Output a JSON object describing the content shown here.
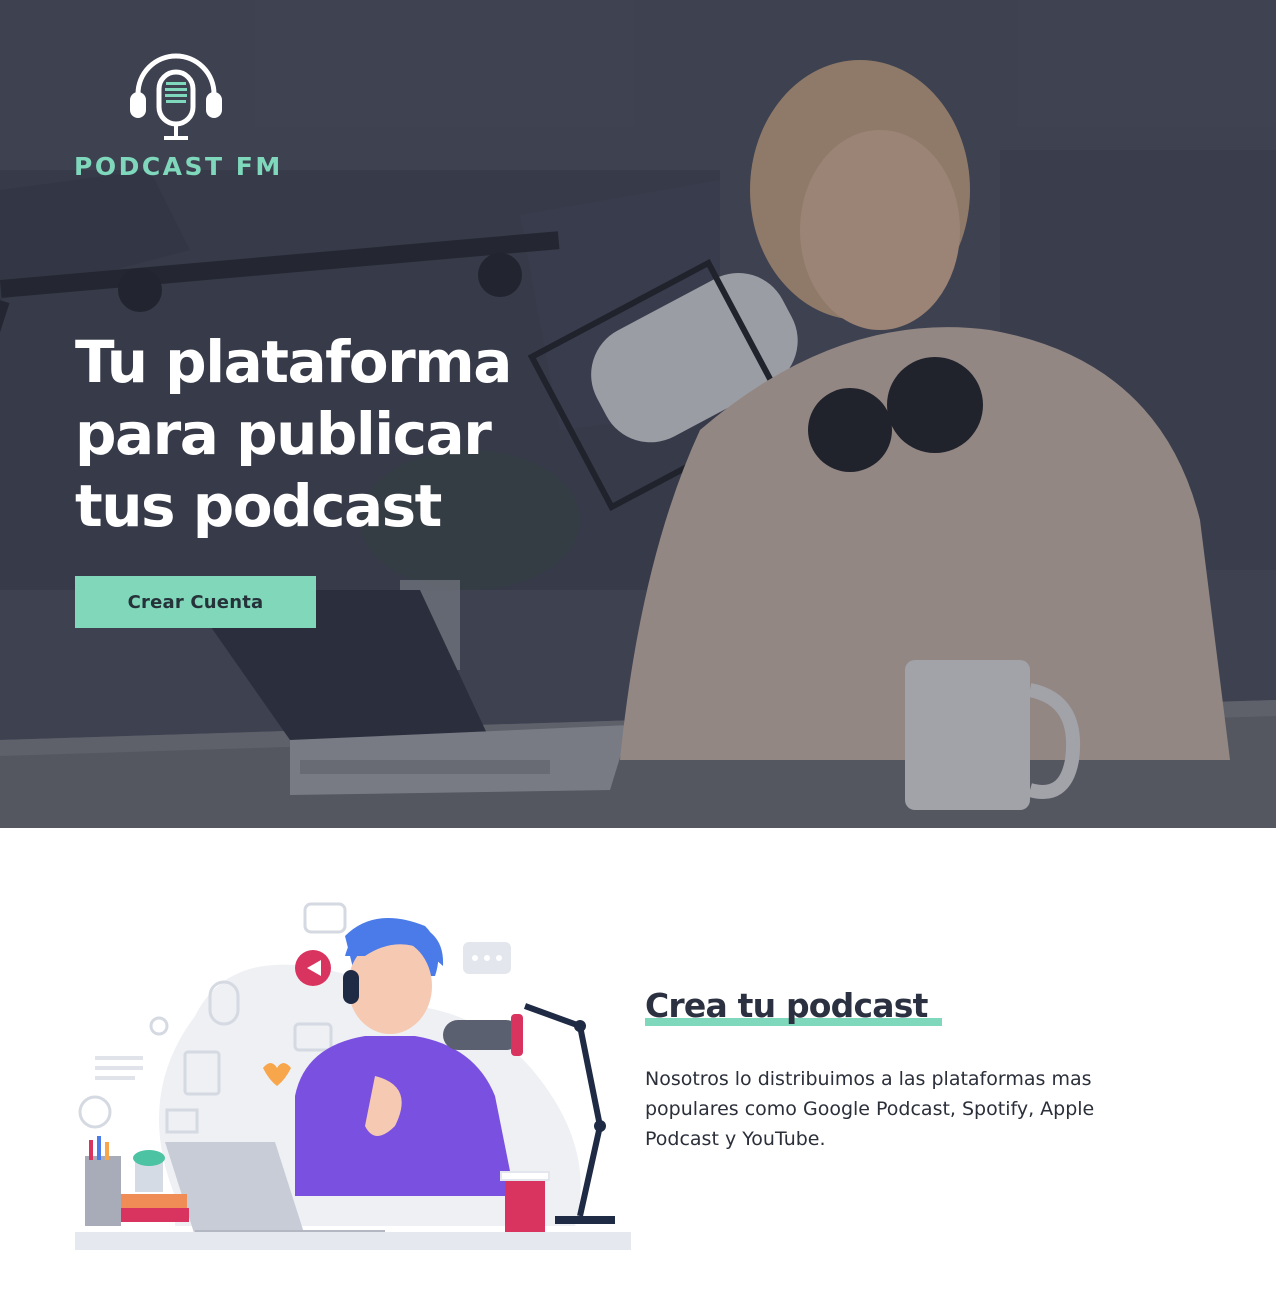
{
  "brand": {
    "name": "PODCAST FM",
    "accent_color": "#7fd8bb",
    "logo_icon": "headphones-microphone-icon"
  },
  "hero": {
    "title_lines": [
      "Tu plataforma",
      "para publicar",
      "tus podcast"
    ],
    "cta_label": "Crear Cuenta",
    "background_image": "woman-recording-podcast-photo"
  },
  "feature": {
    "title": "Crea tu podcast",
    "text": "Nosotros lo distribuimos a las plataformas mas populares como Google Podcast, Spotify, Apple Podcast y YouTube.",
    "illustration": "podcaster-at-desk-illustration"
  }
}
